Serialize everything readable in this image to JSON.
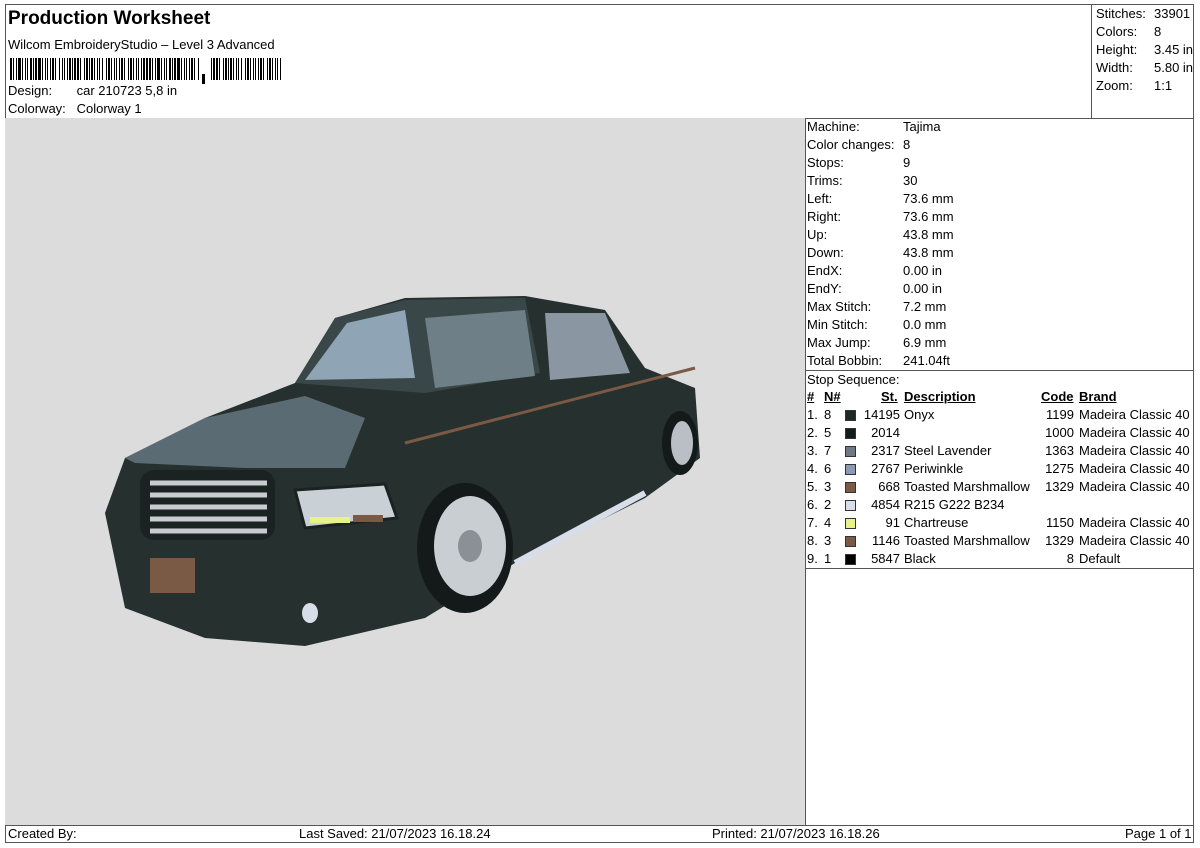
{
  "header": {
    "title": "Production Worksheet",
    "subtitle": "Wilcom EmbroideryStudio – Level 3 Advanced",
    "design_label": "Design:",
    "design_value": "car 210723 5,8 in",
    "colorway_label": "Colorway:",
    "colorway_value": "Colorway 1"
  },
  "stats": [
    {
      "label": "Stitches:",
      "value": "33901"
    },
    {
      "label": "Colors:",
      "value": "8"
    },
    {
      "label": "Height:",
      "value": "3.45 in"
    },
    {
      "label": "Width:",
      "value": "5.80 in"
    },
    {
      "label": "Zoom:",
      "value": "1:1"
    }
  ],
  "machine_info": [
    {
      "label": "Machine:",
      "value": "Tajima"
    },
    {
      "label": "Color changes:",
      "value": "8"
    },
    {
      "label": "Stops:",
      "value": "9"
    },
    {
      "label": "Trims:",
      "value": "30"
    },
    {
      "label": "Left:",
      "value": "73.6 mm"
    },
    {
      "label": "Right:",
      "value": "73.6 mm"
    },
    {
      "label": "Up:",
      "value": "43.8 mm"
    },
    {
      "label": "Down:",
      "value": "43.8 mm"
    },
    {
      "label": "EndX:",
      "value": "0.00 in"
    },
    {
      "label": "EndY:",
      "value": "0.00 in"
    },
    {
      "label": "Max Stitch:",
      "value": "7.2 mm"
    },
    {
      "label": "Min Stitch:",
      "value": "0.0 mm"
    },
    {
      "label": "Max Jump:",
      "value": "6.9 mm"
    },
    {
      "label": "Total Bobbin:",
      "value": "241.04ft"
    }
  ],
  "stop_sequence": {
    "label": "Stop Sequence:",
    "headers": {
      "num": "#",
      "n": "N#",
      "st": "St.",
      "desc": "Description",
      "code": "Code",
      "brand": "Brand"
    },
    "rows": [
      {
        "num": "1.",
        "n": "8",
        "color": "#1f2828",
        "st": "14195",
        "desc": "Onyx",
        "code": "1199",
        "brand": "Madeira Classic 40"
      },
      {
        "num": "2.",
        "n": "5",
        "color": "#141c1c",
        "st": "2014",
        "desc": "",
        "code": "1000",
        "brand": "Madeira Classic 40"
      },
      {
        "num": "3.",
        "n": "7",
        "color": "#6e7886",
        "st": "2317",
        "desc": "Steel Lavender",
        "code": "1363",
        "brand": "Madeira Classic 40"
      },
      {
        "num": "4.",
        "n": "6",
        "color": "#8a9ab4",
        "st": "2767",
        "desc": "Periwinkle",
        "code": "1275",
        "brand": "Madeira Classic 40"
      },
      {
        "num": "5.",
        "n": "3",
        "color": "#7a5a44",
        "st": "668",
        "desc": "Toasted Marshmallow",
        "code": "1329",
        "brand": "Madeira Classic 40"
      },
      {
        "num": "6.",
        "n": "2",
        "color": "#d7dee9",
        "st": "4854",
        "desc": "R215 G222 B234",
        "code": "",
        "brand": ""
      },
      {
        "num": "7.",
        "n": "4",
        "color": "#e8f28a",
        "st": "91",
        "desc": "Chartreuse",
        "code": "1150",
        "brand": "Madeira Classic 40"
      },
      {
        "num": "8.",
        "n": "3",
        "color": "#7a5a44",
        "st": "1146",
        "desc": "Toasted Marshmallow",
        "code": "1329",
        "brand": "Madeira Classic 40"
      },
      {
        "num": "9.",
        "n": "1",
        "color": "#000000",
        "st": "5847",
        "desc": "Black",
        "code": "8",
        "brand": "Default"
      }
    ]
  },
  "footer": {
    "created_by": "Created By:",
    "last_saved": "Last Saved: 21/07/2023 16.18.24",
    "printed": "Printed: 21/07/2023 16.18.26",
    "page": "Page 1 of 1"
  }
}
